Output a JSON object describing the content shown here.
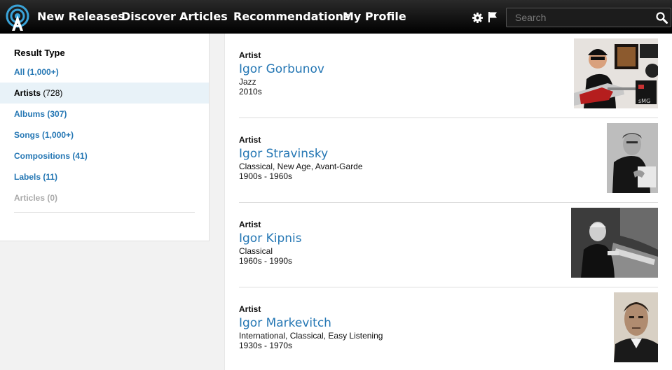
{
  "nav": {
    "items": [
      "New Releases",
      "Discover",
      "Articles",
      "Recommendations",
      "My Profile"
    ]
  },
  "search": {
    "placeholder": "Search"
  },
  "filters": {
    "title": "Result Type",
    "items": [
      {
        "label": "All",
        "count": "(1,000+)"
      },
      {
        "label": "Artists",
        "count": "(728)"
      },
      {
        "label": "Albums",
        "count": "(307)"
      },
      {
        "label": "Songs",
        "count": "(1,000+)"
      },
      {
        "label": "Compositions",
        "count": "(41)"
      },
      {
        "label": "Labels",
        "count": "(11)"
      },
      {
        "label": "Articles",
        "count": "(0)"
      }
    ]
  },
  "results": [
    {
      "type": "Artist",
      "name": "Igor Gorbunov",
      "genre": "Jazz",
      "years": "2010s"
    },
    {
      "type": "Artist",
      "name": "Igor Stravinsky",
      "genre": "Classical, New Age, Avant-Garde",
      "years": "1900s - 1960s"
    },
    {
      "type": "Artist",
      "name": "Igor Kipnis",
      "genre": "Classical",
      "years": "1960s - 1990s"
    },
    {
      "type": "Artist",
      "name": "Igor Markevitch",
      "genre": "International, Classical, Easy Listening",
      "years": "1930s - 1970s"
    }
  ],
  "colors": {
    "link": "#2577b4",
    "active_bg": "#e8f2f8",
    "topbar": "#000000"
  },
  "icons": {
    "logo": "antenna-logo-icon",
    "settings": "gear-icon",
    "flag": "flag-icon",
    "search": "search-icon"
  }
}
